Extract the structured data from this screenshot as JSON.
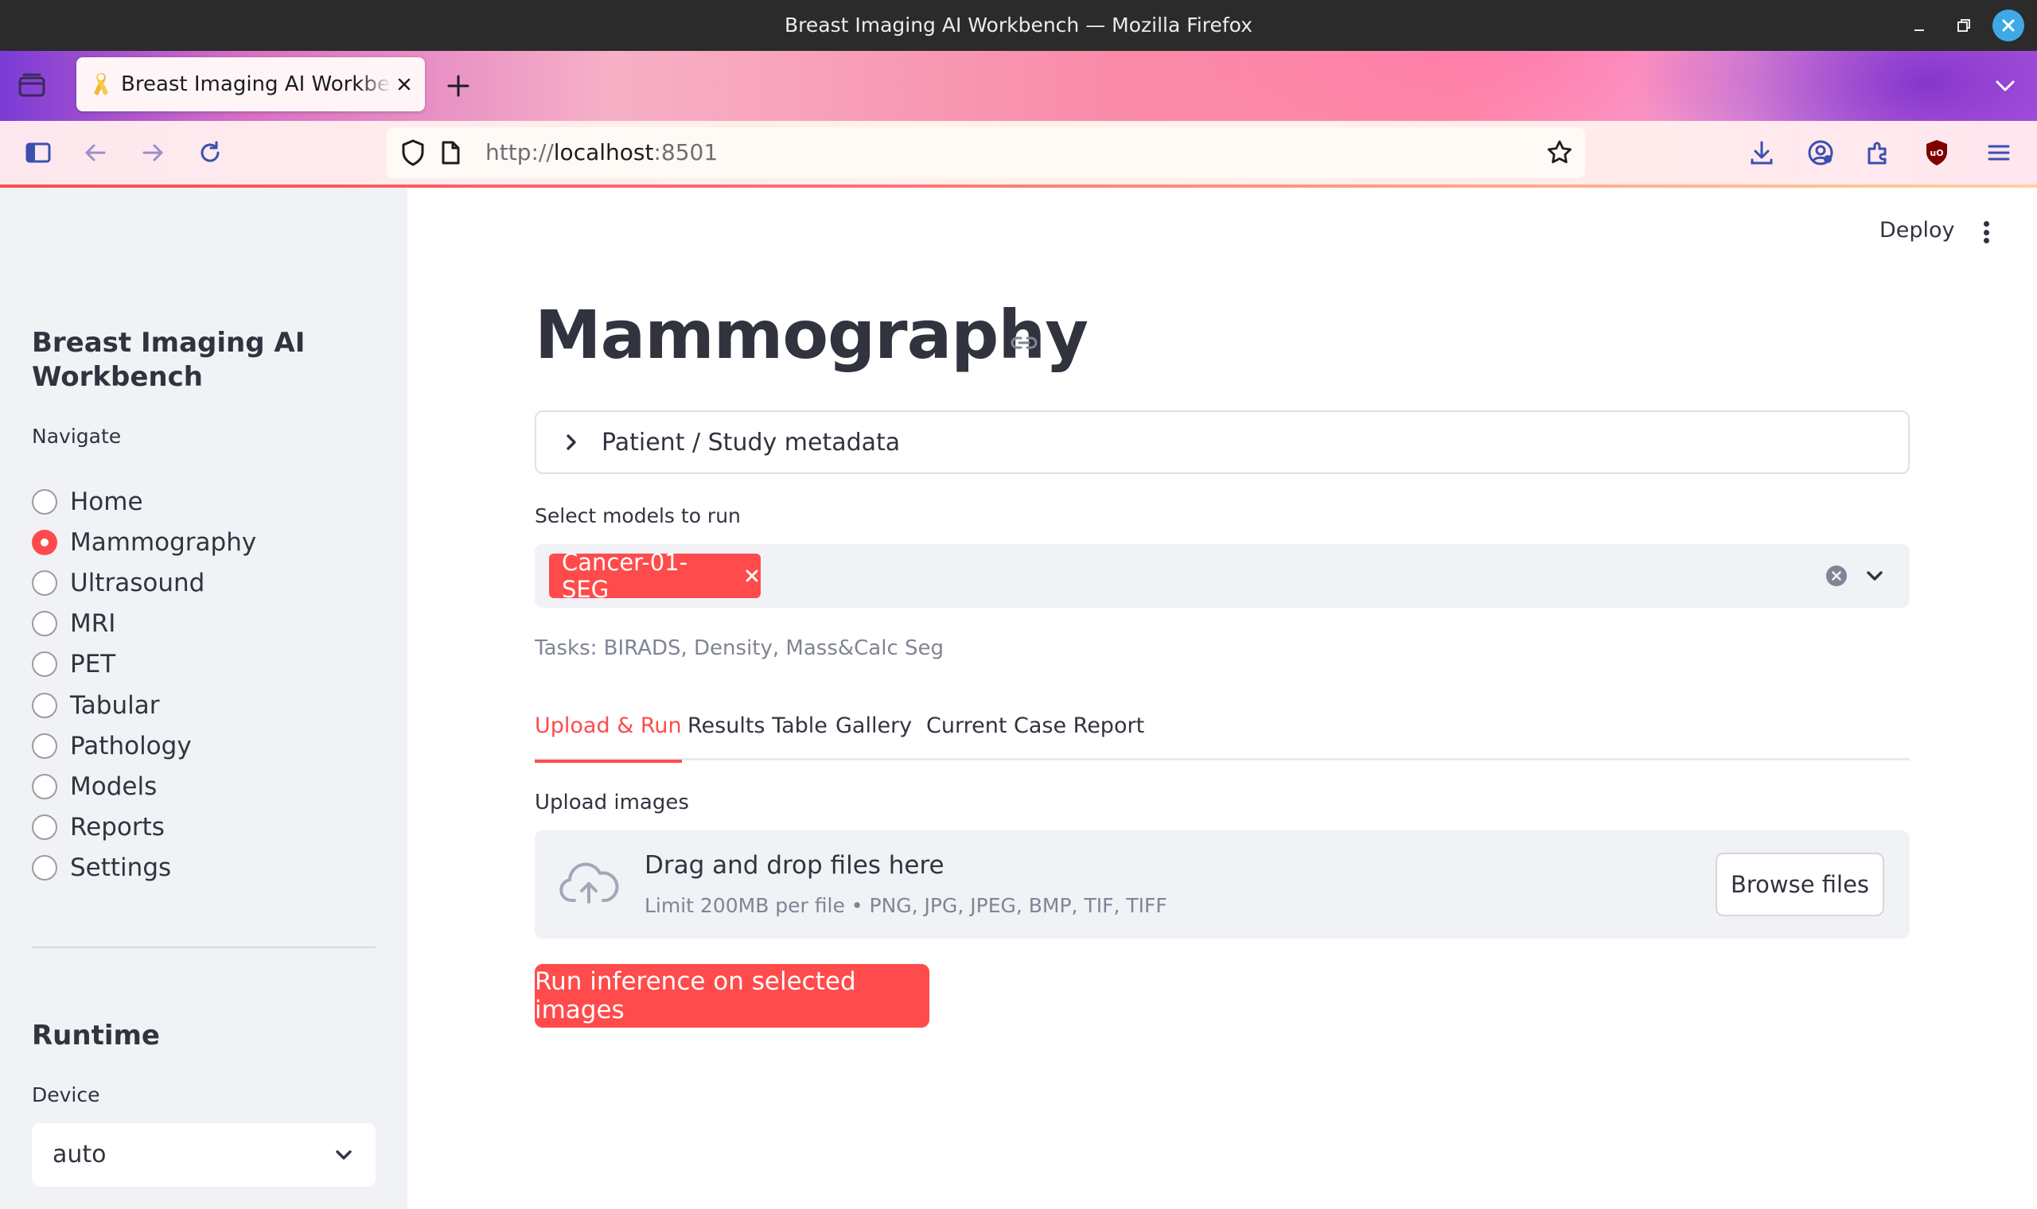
{
  "window": {
    "title": "Breast Imaging AI Workbench — Mozilla Firefox"
  },
  "browser": {
    "tab": {
      "label": "Breast Imaging AI Workbench",
      "favicon": "ribbon-icon"
    },
    "url": {
      "scheme": "http://",
      "host": "localhost",
      "port": ":8501"
    },
    "icons": [
      "sidebar-toggle-icon",
      "back-icon",
      "forward-icon",
      "reload-icon",
      "shield-icon",
      "page-icon",
      "star-icon",
      "download-icon",
      "account-icon",
      "extensions-icon",
      "ublock-icon",
      "menu-icon",
      "tab-list-icon",
      "new-tab-icon"
    ]
  },
  "sidebar": {
    "title": "Breast Imaging AI Workbench",
    "nav_label": "Navigate",
    "nav_items": [
      {
        "label": "Home",
        "selected": false
      },
      {
        "label": "Mammography",
        "selected": true
      },
      {
        "label": "Ultrasound",
        "selected": false
      },
      {
        "label": "MRI",
        "selected": false
      },
      {
        "label": "PET",
        "selected": false
      },
      {
        "label": "Tabular",
        "selected": false
      },
      {
        "label": "Pathology",
        "selected": false
      },
      {
        "label": "Models",
        "selected": false
      },
      {
        "label": "Reports",
        "selected": false
      },
      {
        "label": "Settings",
        "selected": false
      }
    ],
    "runtime_heading": "Runtime",
    "device_label": "Device",
    "device_value": "auto"
  },
  "header": {
    "deploy_label": "Deploy"
  },
  "main": {
    "title": "Mammography",
    "expander_label": "Patient / Study metadata",
    "models_label": "Select models to run",
    "selected_models": [
      "Cancer-01-SEG"
    ],
    "tasks_text": "Tasks: BIRADS, Density, Mass&Calc Seg",
    "tabs": [
      {
        "label": "Upload & Run",
        "active": true
      },
      {
        "label": "Results Table",
        "active": false
      },
      {
        "label": "Gallery",
        "active": false
      },
      {
        "label": "Current Case Report",
        "active": false
      }
    ],
    "upload_label": "Upload images",
    "dropzone_title": "Drag and drop files here",
    "dropzone_sub": "Limit 200MB per file • PNG, JPG, JPEG, BMP, TIF, TIFF",
    "browse_label": "Browse files",
    "run_label": "Run inference on selected images"
  },
  "colors": {
    "accent": "#ff4b4b",
    "sidebar_bg": "#f0f2f6",
    "text": "#31333f",
    "muted": "#808495"
  }
}
